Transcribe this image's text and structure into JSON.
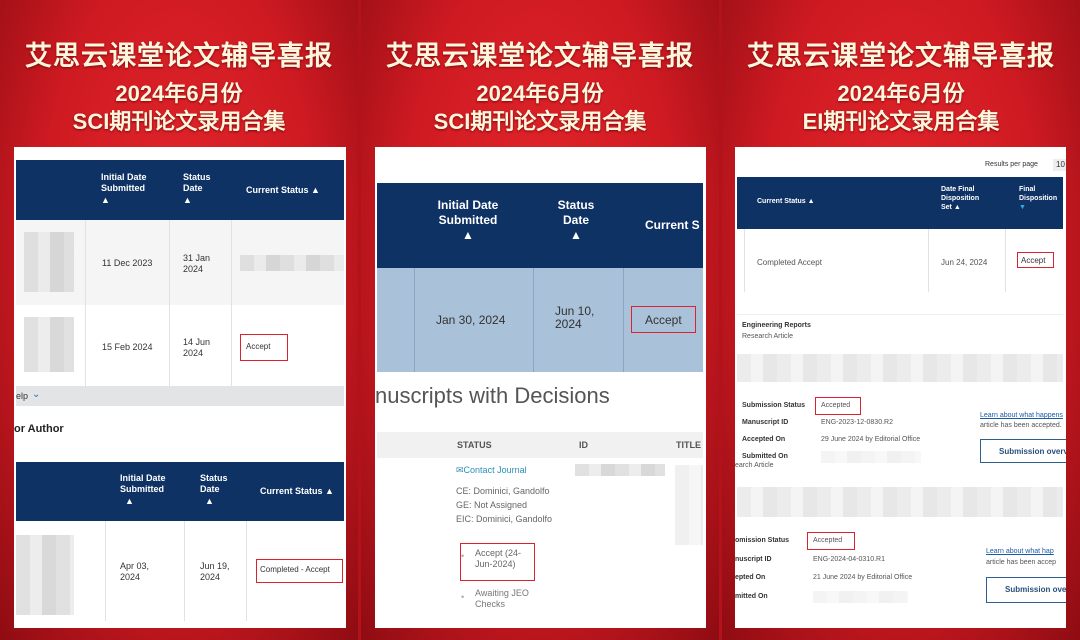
{
  "panels": [
    {
      "title": "艾思云课堂论文辅导喜报",
      "month": "2024年6月份",
      "subtitle": "SCI期刊论文录用合集"
    },
    {
      "title": "艾思云课堂论文辅导喜报",
      "month": "2024年6月份",
      "subtitle": "SCI期刊论文录用合集"
    },
    {
      "title": "艾思云课堂论文辅导喜报",
      "month": "2024年6月份",
      "subtitle": "EI期刊论文录用合集"
    }
  ],
  "left": {
    "headers": [
      "Initial Date Submitted",
      "Status Date",
      "Current Status"
    ],
    "rows": [
      {
        "submitted": "11 Dec 2023",
        "status_date": "31 Jan 2024",
        "status": ""
      },
      {
        "submitted": "15 Feb 2024",
        "status_date": "14 Jun 2024",
        "status": "Accept"
      }
    ],
    "help": "elp",
    "section": "or Author",
    "headers2": [
      "Initial Date Submitted",
      "Status Date",
      "Current Status"
    ],
    "row2": {
      "submitted": "Apr 03, 2024",
      "status_date": "Jun 19, 2024",
      "status": "Completed - Accept"
    }
  },
  "middle": {
    "headers": [
      "Initial Date Submitted",
      "Status Date",
      "Current S"
    ],
    "row": {
      "submitted": "Jan 30, 2024",
      "status_date": "Jun 10, 2024",
      "status": "Accept"
    },
    "section": "nuscripts with Decisions",
    "cols": [
      "STATUS",
      "ID",
      "TITLE"
    ],
    "contact": "Contact Journal",
    "editors": [
      "CE: Dominici, Gandolfo",
      "GE: Not Assigned",
      "EIC: Dominici, Gandolfo"
    ],
    "decision": "Accept (24-Jun-2024)",
    "next": "Awaiting JEO Checks"
  },
  "right": {
    "results_label": "Results per page",
    "results_value": "10",
    "headers": [
      "Current Status",
      "Date Final Disposition Set",
      "Final Disposition"
    ],
    "row": {
      "status": "Completed Accept",
      "date": "Jun 24, 2024",
      "disposition": "Accept"
    },
    "journal": "Engineering Reports",
    "type": "Research Article",
    "s1": {
      "status_label": "Submission Status",
      "status": "Accepted",
      "id_label": "Manuscript ID",
      "id": "ENG-2023-12-0830.R2",
      "acc_label": "Accepted On",
      "acc": "29 June 2024 by Editorial Office",
      "sub_label": "Submitted On",
      "type": "earch Article",
      "link": "Learn about what happens",
      "link2": "article has been accepted.",
      "button": "Submission overview"
    },
    "s2": {
      "status_label": "omission Status",
      "status": "Accepted",
      "id_label": "nuscript ID",
      "id": "ENG-2024-04-0310.R1",
      "acc_label": "epted On",
      "acc": "21 June 2024 by Editorial Office",
      "sub_label": "mitted On",
      "link": "Learn about what hap",
      "link2": "article has been accep",
      "button": "Submission ove"
    }
  },
  "colors": {
    "accent": "#d9232d",
    "navy": "#0f3265",
    "background": "#cf1a22"
  }
}
